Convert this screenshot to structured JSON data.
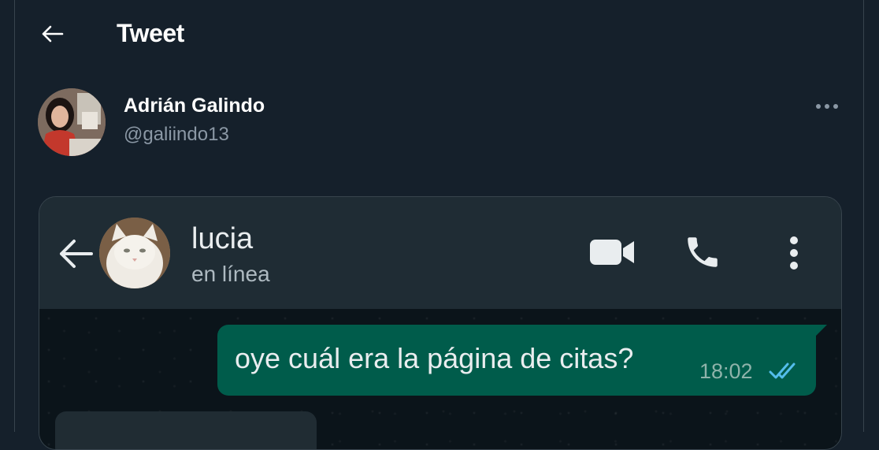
{
  "header": {
    "title": "Tweet",
    "back_icon": "arrow-left-icon"
  },
  "tweet": {
    "author_name": "Adrián Galindo",
    "author_handle": "@galiindo13",
    "more_icon": "more-horizontal-icon"
  },
  "embedded_chat": {
    "contact_name": "lucia",
    "contact_status": "en línea",
    "icons": [
      "arrow-left-icon",
      "video-camera-icon",
      "phone-icon",
      "more-vertical-icon"
    ],
    "messages": [
      {
        "direction": "outgoing",
        "text": "oye cuál era la página de citas?",
        "time": "18:02",
        "read": true
      }
    ]
  },
  "colors": {
    "background": "#15202b",
    "border": "#38444d",
    "secondary_text": "#8b98a5",
    "whatsapp_header": "#1f2c34",
    "whatsapp_chat_bg": "#0b141a",
    "outgoing_bubble": "#005c4b",
    "read_ticks": "#53bdeb"
  }
}
